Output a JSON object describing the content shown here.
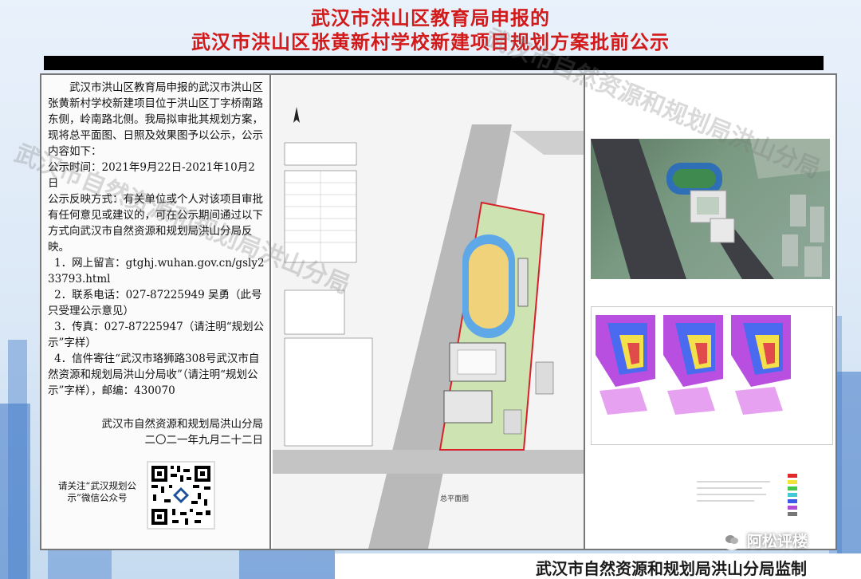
{
  "header": {
    "title_line1": "武汉市洪山区教育局申报的",
    "title_line2": "武汉市洪山区张黄新村学校新建项目规划方案批前公示"
  },
  "notice": {
    "intro": "武汉市洪山区教育局申报的武汉市洪山区张黄新村学校新建项目位于洪山区丁字桥南路东侧，岭南路北侧。我局拟审批其规划方案，现将总平面图、日照及效果图予以公示，公示内容如下：",
    "period": "公示时间：2021年9月22日-2021年10月2日",
    "feedback_intro": "公示反映方式：有关单位或个人对该项目审批有任何意见或建议的，可在公示期间通过以下方式向武汉市自然资源和规划局洪山分局反映。",
    "item1": "1．网上留言：gtghj.wuhan.gov.cn/gsly233793.html",
    "item2": "2．联系电话：027-87225949 吴勇（此号只受理公示意见）",
    "item3": "3．传真：027-87225947（请注明“规划公示”字样）",
    "item4": "4．信件寄往“武汉市珞狮路308号武汉市自然资源和规划局洪山分局收”（请注明“规划公示”字样），邮编：430070",
    "sign_org": "武汉市自然资源和规划局洪山分局",
    "sign_date": "二〇二一年九月二十二日"
  },
  "qr": {
    "label": "请关注“武汉规划公示”微信公众号"
  },
  "plan": {
    "caption": "总平面图"
  },
  "watermarks": {
    "text1": "武汉市自然资源和规划局洪山分局",
    "text2": "武汉市自然资源和规划局洪山分局"
  },
  "footer": {
    "supervisor": "武汉市自然资源和规划局洪山分局监制",
    "brand": "阿松评楼"
  },
  "colors": {
    "title_red": "#d21a1a",
    "sky_blue": "#3f78c7",
    "border_gray": "#777777"
  }
}
